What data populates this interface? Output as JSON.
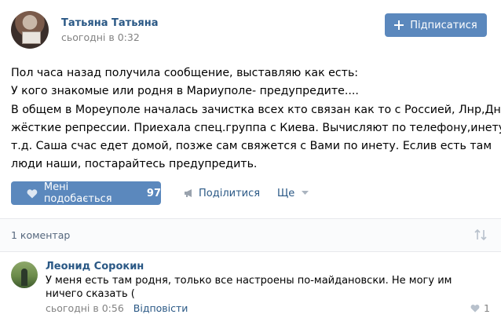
{
  "post": {
    "author": "Татьяна Татьяна",
    "date": "сьогодні в 0:32",
    "subscribe_label": "Підписатися",
    "text_lines": [
      "Пол часа назад получила сообщение, выставляю как есть:",
      "У кого знакомые или родня в Мариуполе- предупредите....",
      "В общем в Мореуполе началась зачистка всех кто связан как то с Россией, Лнр,Днр,",
      "жёсткие репрессии. Приехала спец.группа с Киева. Вычисляют по телефону,инету, и",
      "т.д. Саша счас едет домой, позже сам свяжется с Вами по инету. Еслив есть там",
      "люди наши, постарайтесь предупредить."
    ],
    "like_label": "Мені подобається",
    "like_count": "97",
    "share_label": "Поділитися",
    "more_label": "Ще"
  },
  "comments_header": {
    "count_label": "1 коментар"
  },
  "comment": {
    "author": "Леонид Сорокин",
    "text": "У меня есть там родня, только все настроены по-майдановски. Не могу им ничего сказать (",
    "date": "сьогодні в 0:56",
    "reply_label": "Відповісти",
    "like_count": "1"
  },
  "colors": {
    "accent": "#5b88bd",
    "link": "#2a5885",
    "muted": "#828282"
  },
  "icons": [
    "plus-icon",
    "heart-icon",
    "megaphone-icon",
    "chevron-down-icon",
    "sort-arrows-icon"
  ]
}
